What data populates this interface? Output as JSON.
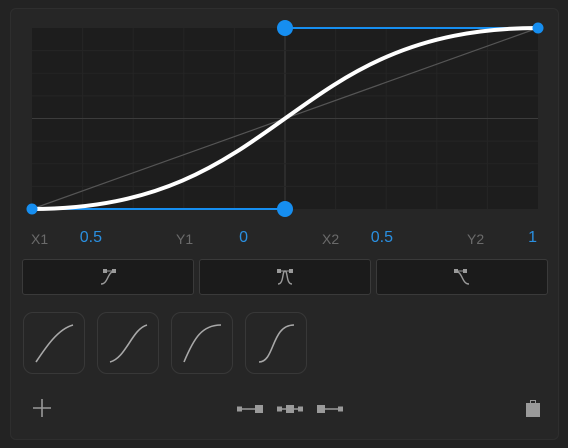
{
  "curve": {
    "p1": {
      "label": "X1",
      "value": "0.5"
    },
    "p2": {
      "label": "Y1",
      "value": "0"
    },
    "p3": {
      "label": "X2",
      "value": "0.5"
    },
    "p4": {
      "label": "Y2",
      "value": "1"
    },
    "x1": 0.5,
    "y1": 0.0,
    "x2": 0.5,
    "y2": 1.0
  },
  "colors": {
    "accent": "#168ef0",
    "curve": "#ffffff",
    "background": "#232323"
  },
  "presets": [
    {
      "icon": "ease-in-icon"
    },
    {
      "icon": "ease-in-out-icon"
    },
    {
      "icon": "ease-out-icon"
    }
  ],
  "curve_presets": [
    {
      "icon": "ease-out-curve-icon"
    },
    {
      "icon": "ease-in-out-curve-icon"
    },
    {
      "icon": "ease-out-strong-curve-icon"
    },
    {
      "icon": "ease-in-out-strong-curve-icon"
    }
  ],
  "toolbar": {
    "add_icon": "plus-icon",
    "distribute_icons": [
      "align-left-icon",
      "align-center-icon",
      "align-right-icon"
    ],
    "clipboard_icon": "paste-icon"
  }
}
